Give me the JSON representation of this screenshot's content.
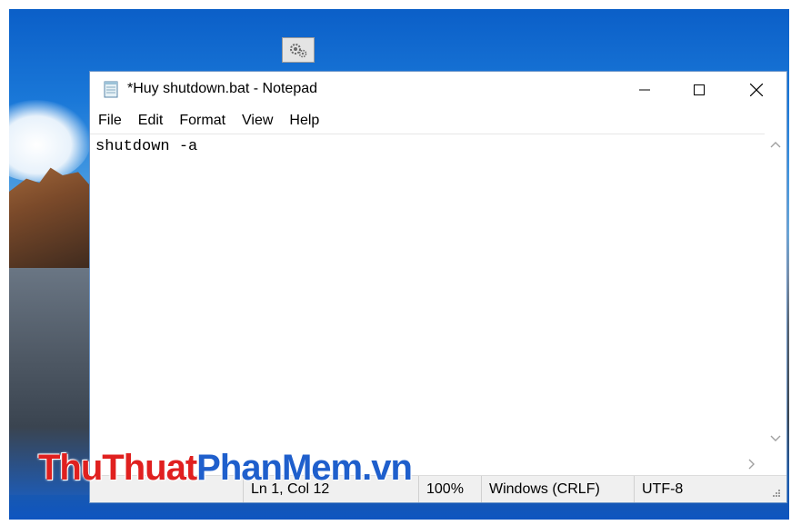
{
  "desktop": {
    "gear_icon": "gear-icon"
  },
  "window": {
    "title": "*Huy shutdown.bat - Notepad",
    "controls": {
      "minimize": "minimize-icon",
      "maximize": "maximize-icon",
      "close": "close-icon"
    }
  },
  "menu": [
    "File",
    "Edit",
    "Format",
    "View",
    "Help"
  ],
  "editor": {
    "content": "shutdown -a"
  },
  "status": {
    "position": "Ln 1, Col 12",
    "zoom": "100%",
    "line_ending": "Windows (CRLF)",
    "encoding": "UTF-8"
  },
  "watermark": {
    "part1": "ThuThuat",
    "part2": "PhanMem",
    "part3": ".vn",
    "colors": {
      "part1": "#e0201f",
      "part2": "#1f5fcc",
      "part3": "#1f5fcc"
    }
  }
}
